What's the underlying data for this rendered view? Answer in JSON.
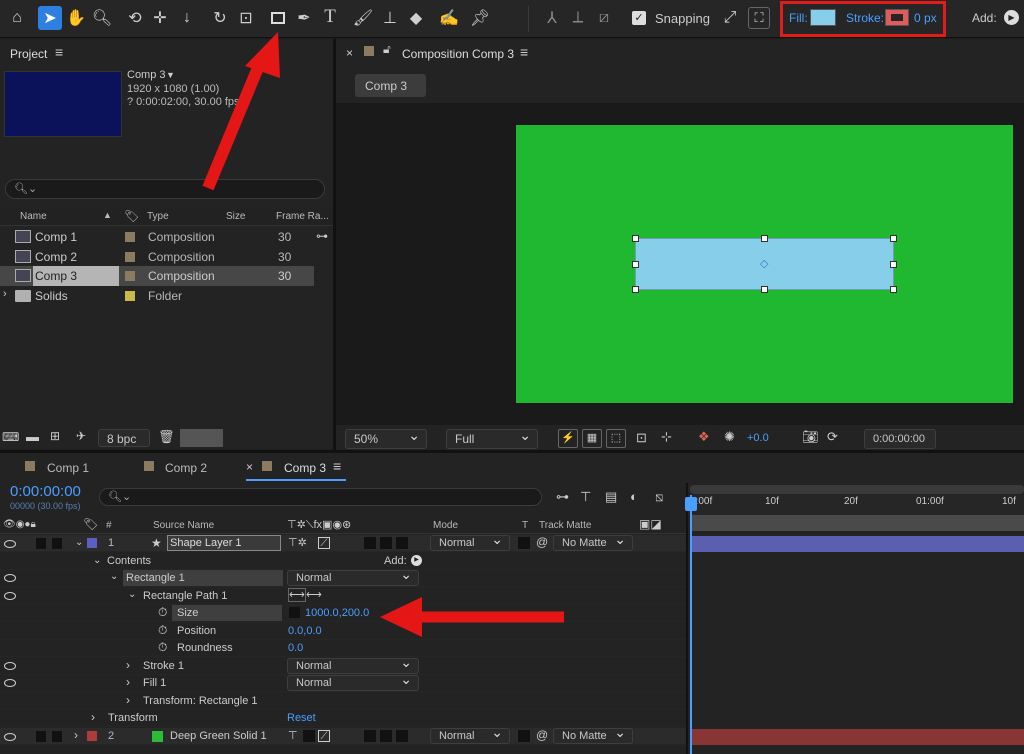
{
  "toolbar": {
    "snapping_label": "Snapping",
    "fill_label": "Fill:",
    "stroke_label": "Stroke:",
    "stroke_value": "0 px",
    "add_label": "Add:",
    "fill_color": "#87ceeb",
    "stroke_color": "#e05c5c"
  },
  "project": {
    "panel_title": "Project",
    "comp_name": "Comp 3",
    "comp_dims": "1920 x 1080 (1.00)",
    "comp_duration": "? 0:00:02:00, 30.00 fps",
    "columns": [
      "Name",
      "Type",
      "Size",
      "Frame Ra..."
    ],
    "items": [
      {
        "name": "Comp 1",
        "type": "Composition",
        "frame_rate": "30",
        "color": "#8b7b60"
      },
      {
        "name": "Comp 2",
        "type": "Composition",
        "frame_rate": "30",
        "color": "#8b7b60"
      },
      {
        "name": "Comp 3",
        "type": "Composition",
        "frame_rate": "30",
        "color": "#8b7b60"
      },
      {
        "name": "Solids",
        "type": "Folder",
        "frame_rate": "",
        "color": "#c9b84a"
      }
    ],
    "bpc_label": "8 bpc"
  },
  "viewer": {
    "panel_title": "Composition Comp 3",
    "comp_tab": "Comp 3",
    "zoom": "50%",
    "resolution": "Full",
    "exposure": "+0.0",
    "timecode": "0:00:00:00",
    "bg_color": "#1fb830",
    "shape_color": "#87ceeb"
  },
  "timeline": {
    "tabs": [
      "Comp 1",
      "Comp 2",
      "Comp 3"
    ],
    "current_time": "0:00:00:00",
    "frame_info": "00000 (30.00 fps)",
    "columns": {
      "num": "#",
      "source_name": "Source Name",
      "mode": "Mode",
      "t": "T",
      "track_matte": "Track Matte"
    },
    "ruler_labels": [
      "0:00f",
      "10f",
      "20f",
      "01:00f",
      "10f"
    ],
    "layer1": {
      "num": "1",
      "name": "Shape Layer 1",
      "mode": "Normal",
      "matte": "No Matte",
      "color": "#5a5fc0"
    },
    "contents_label": "Contents",
    "add_label": "Add:",
    "rect_label": "Rectangle 1",
    "rect_mode": "Normal",
    "rect_path_label": "Rectangle Path 1",
    "size_label": "Size",
    "size_value": "1000.0,200.0",
    "position_label": "Position",
    "position_value": "0.0,0.0",
    "roundness_label": "Roundness",
    "roundness_value": "0.0",
    "stroke_label": "Stroke 1",
    "stroke_mode": "Normal",
    "fill_label": "Fill 1",
    "fill_mode": "Normal",
    "transform_rect_label": "Transform: Rectangle 1",
    "transform_label": "Transform",
    "reset_label": "Reset",
    "layer2": {
      "num": "2",
      "name": "Deep Green Solid 1",
      "mode": "Normal",
      "matte": "No Matte",
      "color": "#b03a3a",
      "swatch": "#2dbb3a"
    }
  }
}
